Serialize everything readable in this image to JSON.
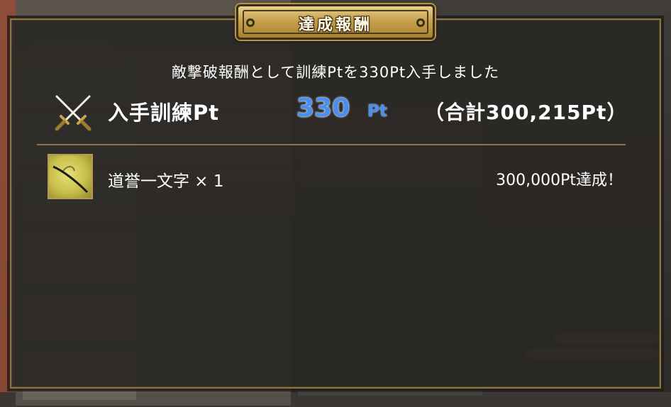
{
  "dialog": {
    "title": "達成報酬",
    "message": "敵撃破報酬として訓練Ptを330Pt入手しました"
  },
  "training": {
    "label": "入手訓練Pt",
    "value": "330",
    "unit": "Pt",
    "total_text": "（合計300,215Pt）"
  },
  "reward": {
    "item_name": "道誉一文字 × 1",
    "achievement": "300,000Pt達成！"
  },
  "colors": {
    "accent_blue": "#4a8ff0",
    "gold_border": "#8c7540",
    "title_gold": "#c7a24e"
  },
  "icons": {
    "swords": "crossed-swords-icon",
    "item": "katana-item-icon"
  }
}
